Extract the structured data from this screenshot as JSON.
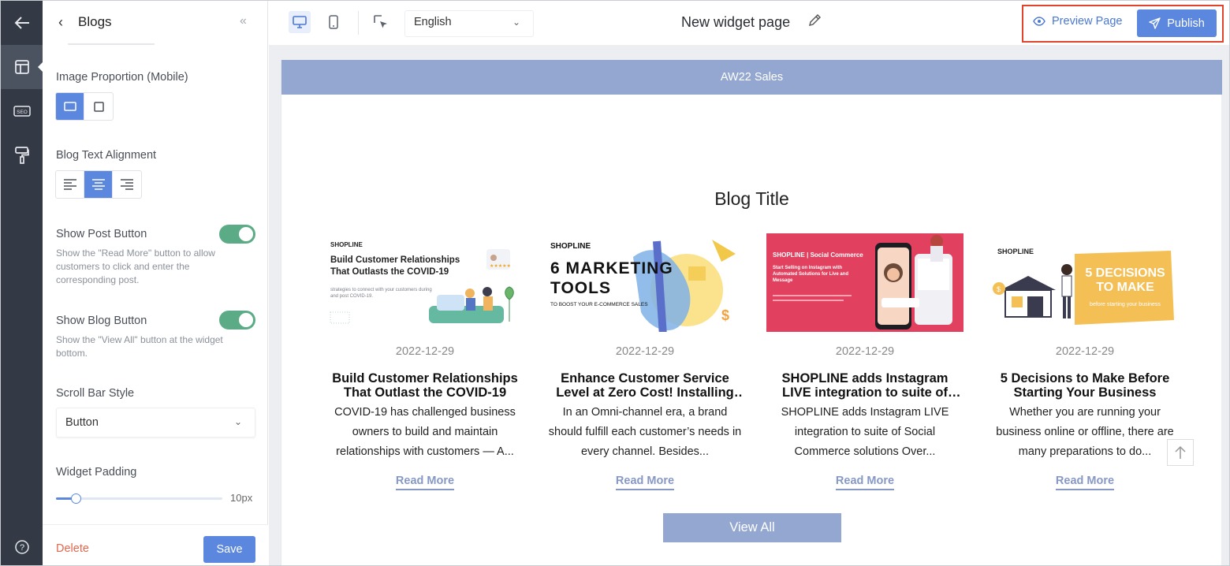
{
  "panel": {
    "title": "Blogs",
    "image_proportion_label": "Image Proportion (Mobile)",
    "text_alignment_label": "Blog Text Alignment",
    "show_post_button_label": "Show Post Button",
    "show_post_button_desc": "Show the \"Read More\" button to allow customers to click and enter the corresponding post.",
    "show_post_button_on": true,
    "show_blog_button_label": "Show Blog Button",
    "show_blog_button_desc": "Show the \"View All\" button at the widget bottom.",
    "show_blog_button_on": true,
    "scroll_bar_style_label": "Scroll Bar Style",
    "scroll_bar_style_value": "Button",
    "widget_padding_label": "Widget Padding",
    "widget_padding_value": "10px",
    "widget_padding_fraction": 0.12,
    "delete_label": "Delete",
    "save_label": "Save"
  },
  "topbar": {
    "language": "English",
    "page_title": "New widget page",
    "preview_label": "Preview Page",
    "publish_label": "Publish"
  },
  "canvas": {
    "banner_text": "AW22 Sales",
    "blog_title": "Blog Title",
    "view_all_label": "View All",
    "posts": [
      {
        "date": "2022-12-29",
        "title": "Build Customer Relationships That Outlast the COVID-19",
        "excerpt": "COVID-19 has challenged business owners to build and maintain relationships with customers — A...",
        "read_more": "Read More",
        "image": {
          "brand": "SHOPLINE",
          "headline": "Build Customer Relationships That Outlasts the COVID-19",
          "sub": "strategies to connect with your customers during and post COVID-19."
        }
      },
      {
        "date": "2022-12-29",
        "title": "Enhance Customer Service Level at Zero Cost! Installing live chat",
        "excerpt": "In an Omni-channel era, a brand should fulfill each customer’s needs in every channel. Besides...",
        "read_more": "Read More",
        "image": {
          "brand": "SHOPLINE",
          "headline": "6 MARKETING TOOLS",
          "sub": "TO BOOST YOUR E-COMMERCE SALES"
        }
      },
      {
        "date": "2022-12-29",
        "title": "SHOPLINE adds Instagram LIVE integration to suite of Social Commerce",
        "excerpt": "SHOPLINE adds Instagram LIVE integration to suite of Social Commerce solutions Over...",
        "read_more": "Read More",
        "image": {
          "brand": "SHOPLINE | Social Commerce",
          "headline": "Start Selling on Instagram with Automated Solutions for Live and Message",
          "sub": ""
        }
      },
      {
        "date": "2022-12-29",
        "title": "5 Decisions to Make Before Starting Your Business",
        "excerpt": "Whether you are running your business online or offline, there are many preparations to do...",
        "read_more": "Read More",
        "image": {
          "brand": "SHOPLINE",
          "headline": "5 DECISIONS TO MAKE",
          "sub": "before starting your business"
        }
      }
    ]
  },
  "colors": {
    "rail": "#333a45",
    "accent": "#5b87de",
    "toggle_on": "#5bab86",
    "banner": "#94a7d0",
    "highlight_border": "#e0452b",
    "delete": "#e2684f"
  },
  "icons": {
    "rail": [
      "arrow-left-icon",
      "layout-icon",
      "seo-icon",
      "paint-roller-icon",
      "help-icon"
    ],
    "devices": [
      "desktop-icon",
      "mobile-icon",
      "cursor-select-icon"
    ]
  }
}
